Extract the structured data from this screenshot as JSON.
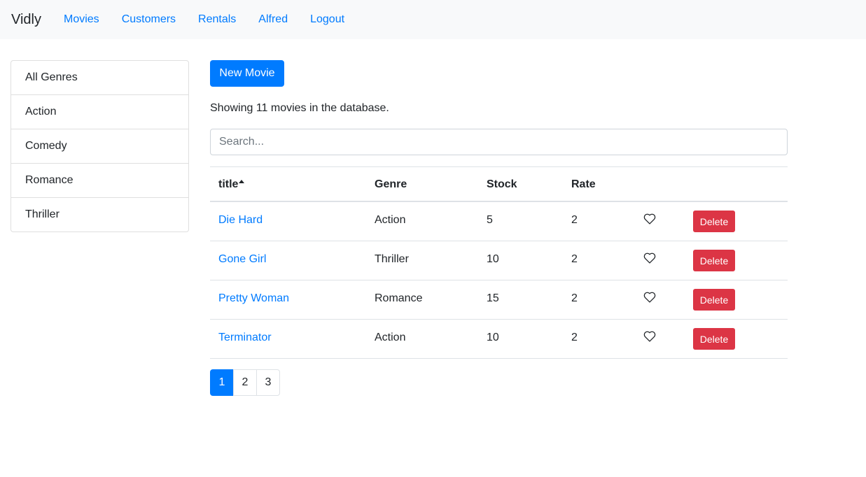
{
  "navbar": {
    "brand": "Vidly",
    "links": [
      "Movies",
      "Customers",
      "Rentals",
      "Alfred",
      "Logout"
    ]
  },
  "genres": [
    "All Genres",
    "Action",
    "Comedy",
    "Romance",
    "Thriller"
  ],
  "main": {
    "new_movie_label": "New Movie",
    "count_text": "Showing 11 movies in the database.",
    "search_placeholder": "Search..."
  },
  "table": {
    "headers": [
      "title",
      "Genre",
      "Stock",
      "Rate"
    ],
    "sort_column": "title",
    "rows": [
      {
        "title": "Die Hard",
        "genre": "Action",
        "stock": "5",
        "rate": "2",
        "delete_label": "Delete"
      },
      {
        "title": "Gone Girl",
        "genre": "Thriller",
        "stock": "10",
        "rate": "2",
        "delete_label": "Delete"
      },
      {
        "title": "Pretty Woman",
        "genre": "Romance",
        "stock": "15",
        "rate": "2",
        "delete_label": "Delete"
      },
      {
        "title": "Terminator",
        "genre": "Action",
        "stock": "10",
        "rate": "2",
        "delete_label": "Delete"
      }
    ]
  },
  "pagination": {
    "pages": [
      "1",
      "2",
      "3"
    ],
    "current": "1"
  },
  "colors": {
    "primary": "#007bff",
    "danger": "#dc3545",
    "navbar_bg": "#f8f9fa"
  },
  "icons": {
    "like": "heart-outline-icon",
    "sort": "caret-up-icon"
  }
}
